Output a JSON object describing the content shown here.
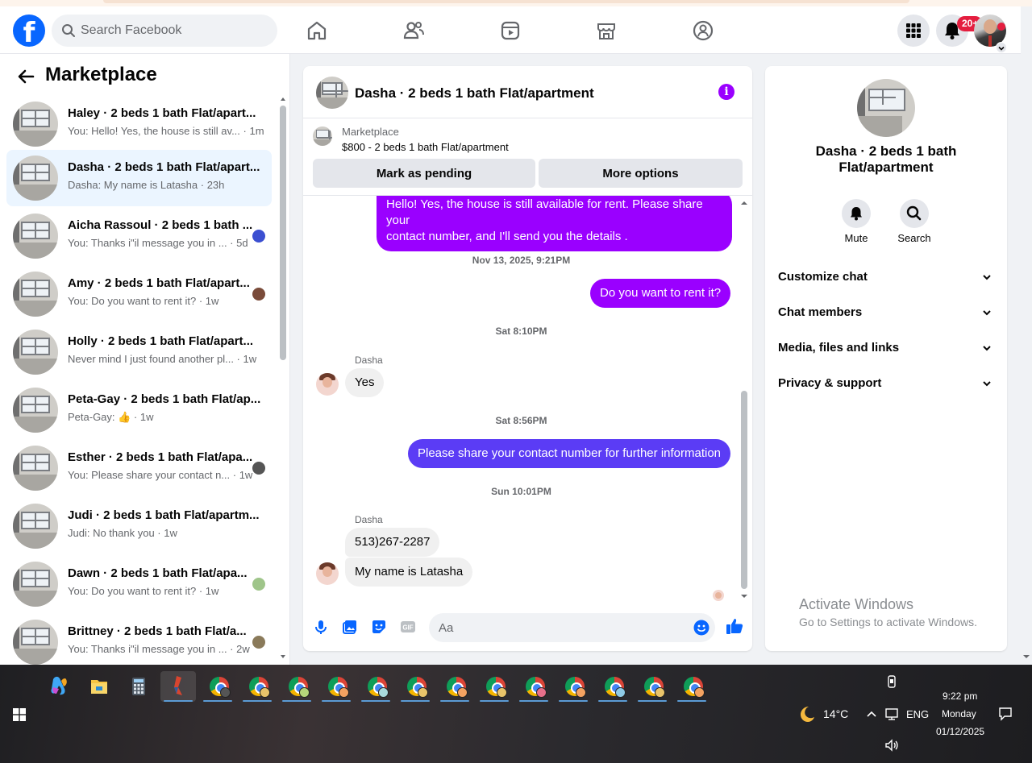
{
  "header": {
    "search_placeholder": "Search Facebook",
    "notification_badge": "20+"
  },
  "sidebar": {
    "title": "Marketplace",
    "conversations": [
      {
        "title": "Haley · 2 beds 1 bath Flat/apart...",
        "snippet": "You: Hello! Yes, the house is still av... · 1m"
      },
      {
        "title": "Dasha · 2 beds 1 bath Flat/apart...",
        "snippet": "Dasha: My name is Latasha · 23h"
      },
      {
        "title": "Aicha Rassoul · 2 beds 1 bath ...",
        "snippet": "You: Thanks i\"il message you in ... · 5d"
      },
      {
        "title": "Amy · 2 beds 1 bath Flat/apart...",
        "snippet": "You: Do you want to rent it? · 1w"
      },
      {
        "title": "Holly · 2 beds 1 bath Flat/apart...",
        "snippet": "Never mind I just found another pl... · 1w"
      },
      {
        "title": "Peta-Gay · 2 beds 1 bath Flat/ap...",
        "snippet": "Peta-Gay: 👍 · 1w"
      },
      {
        "title": "Esther · 2 beds 1 bath Flat/apa...",
        "snippet": "You: Please share your contact n... · 1w"
      },
      {
        "title": "Judi · 2 beds 1 bath Flat/apartm...",
        "snippet": "Judi: No thank you · 1w"
      },
      {
        "title": "Dawn · 2 beds 1 bath Flat/apa...",
        "snippet": "You: Do you want to rent it? · 1w"
      },
      {
        "title": "Brittney · 2 beds 1 bath Flat/a...",
        "snippet": "You: Thanks i\"il message you in ... · 2w"
      }
    ]
  },
  "chat": {
    "header_name": "Dasha · 2 beds 1 bath Flat/apartment",
    "listing_source": "Marketplace",
    "listing_text": "$800 - 2 beds 1 bath Flat/apartment",
    "mark_pending_label": "Mark as pending",
    "more_options_label": "More options",
    "messages": {
      "m1_line1": "Hello! Yes, the house is still available for rent. Please share your",
      "m1_line2": "contact number, and I'll send you the details .",
      "ts1": "Nov 13, 2025, 9:21PM",
      "m2": "Do you want to rent it?",
      "ts2": "Sat 8:10PM",
      "sender1": "Dasha",
      "m3": "Yes",
      "ts3": "Sat 8:56PM",
      "m4": "Please share your contact number for further information",
      "ts4": "Sun 10:01PM",
      "sender2": "Dasha",
      "m5": "513)267-2287",
      "m6": "My name is Latasha"
    },
    "composer_placeholder": "Aa"
  },
  "details": {
    "name": "Dasha · 2 beds 1 bath Flat/apartment",
    "mute_label": "Mute",
    "search_label": "Search",
    "sections": [
      "Customize chat",
      "Chat members",
      "Media, files and links",
      "Privacy & support"
    ]
  },
  "watermark": {
    "line1": "Activate Windows",
    "line2": "Go to Settings to activate Windows."
  },
  "taskbar": {
    "weather_temp": "14°C",
    "language": "ENG",
    "time": "9:22 pm",
    "day": "Monday",
    "date": "01/12/2025"
  },
  "colors": {
    "accent": "#0866ff",
    "outgoing_bubble": "#9a00ff",
    "outgoing_bubble_alt": "#5b3cf5",
    "badge": "#e41e3f"
  }
}
